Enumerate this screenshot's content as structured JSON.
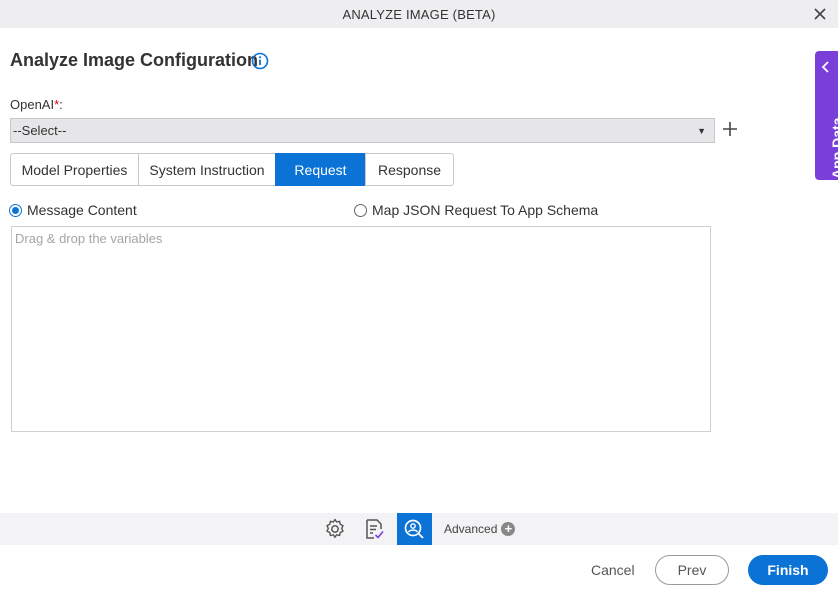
{
  "window": {
    "title": "ANALYZE IMAGE (BETA)"
  },
  "page": {
    "heading": "Analyze Image Configuration"
  },
  "openai": {
    "label": "OpenAI",
    "required_mark": "*",
    "colon": ":",
    "selected": "--Select--"
  },
  "tabs": [
    {
      "label": "Model Properties",
      "active": false
    },
    {
      "label": "System Instruction",
      "active": false
    },
    {
      "label": "Request",
      "active": true
    },
    {
      "label": "Response",
      "active": false
    }
  ],
  "request": {
    "options": [
      {
        "label": "Message Content",
        "checked": true
      },
      {
        "label": "Map JSON Request To App Schema",
        "checked": false
      }
    ],
    "placeholder": "Drag & drop the variables"
  },
  "side_panel": {
    "label": "App Data"
  },
  "toolbar": {
    "advanced_label": "Advanced"
  },
  "footer": {
    "cancel": "Cancel",
    "prev": "Prev",
    "finish": "Finish"
  },
  "colors": {
    "accent": "#0b72d6",
    "side_panel": "#7b3fd9",
    "required": "#d0021b"
  }
}
